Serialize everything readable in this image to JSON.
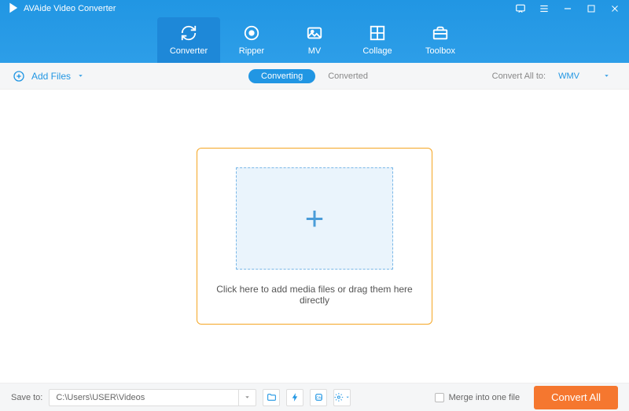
{
  "app": {
    "title": "AVAide Video Converter"
  },
  "tabs": [
    {
      "label": "Converter",
      "icon": "converter"
    },
    {
      "label": "Ripper",
      "icon": "ripper"
    },
    {
      "label": "MV",
      "icon": "mv"
    },
    {
      "label": "Collage",
      "icon": "collage"
    },
    {
      "label": "Toolbox",
      "icon": "toolbox"
    }
  ],
  "subbar": {
    "add_files": "Add Files",
    "converting": "Converting",
    "converted": "Converted",
    "convert_all_label": "Convert All to:",
    "format": "WMV"
  },
  "dropzone": {
    "text": "Click here to add media files or drag them here directly"
  },
  "footer": {
    "save_label": "Save to:",
    "save_path": "C:\\Users\\USER\\Videos",
    "merge_label": "Merge into one file",
    "convert_button": "Convert All"
  },
  "colors": {
    "primary": "#2196e3",
    "accent": "#f5772f",
    "highlight": "#f5a623"
  }
}
